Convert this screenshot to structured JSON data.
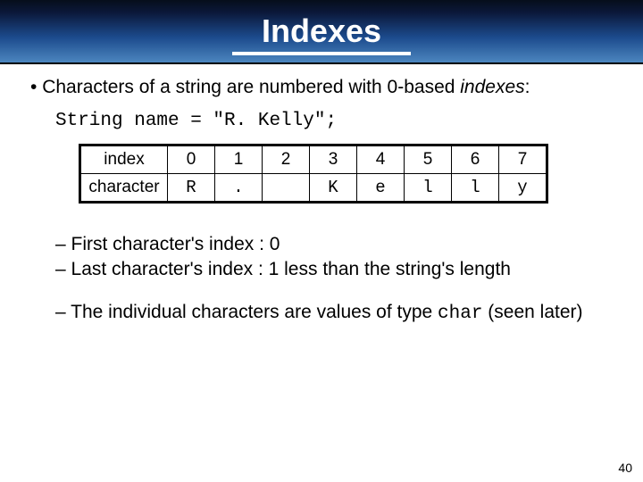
{
  "title": "Indexes",
  "bullet_main_pre": "Characters of a string are numbered with 0-based ",
  "bullet_main_em": "indexes",
  "bullet_main_post": ":",
  "code_line": "String name = \"R. Kelly\";",
  "table": {
    "row_labels": [
      "index",
      "character"
    ],
    "indices": [
      "0",
      "1",
      "2",
      "3",
      "4",
      "5",
      "6",
      "7"
    ],
    "characters": [
      "R",
      ".",
      " ",
      "K",
      "e",
      "l",
      "l",
      "y"
    ]
  },
  "sub_bullets": {
    "b1": "First character's index : 0",
    "b2": "Last character's index : 1 less than the string's length",
    "b3_pre": "The individual characters are values of type ",
    "b3_code": "char",
    "b3_post": " (seen later)"
  },
  "page_number": "40"
}
